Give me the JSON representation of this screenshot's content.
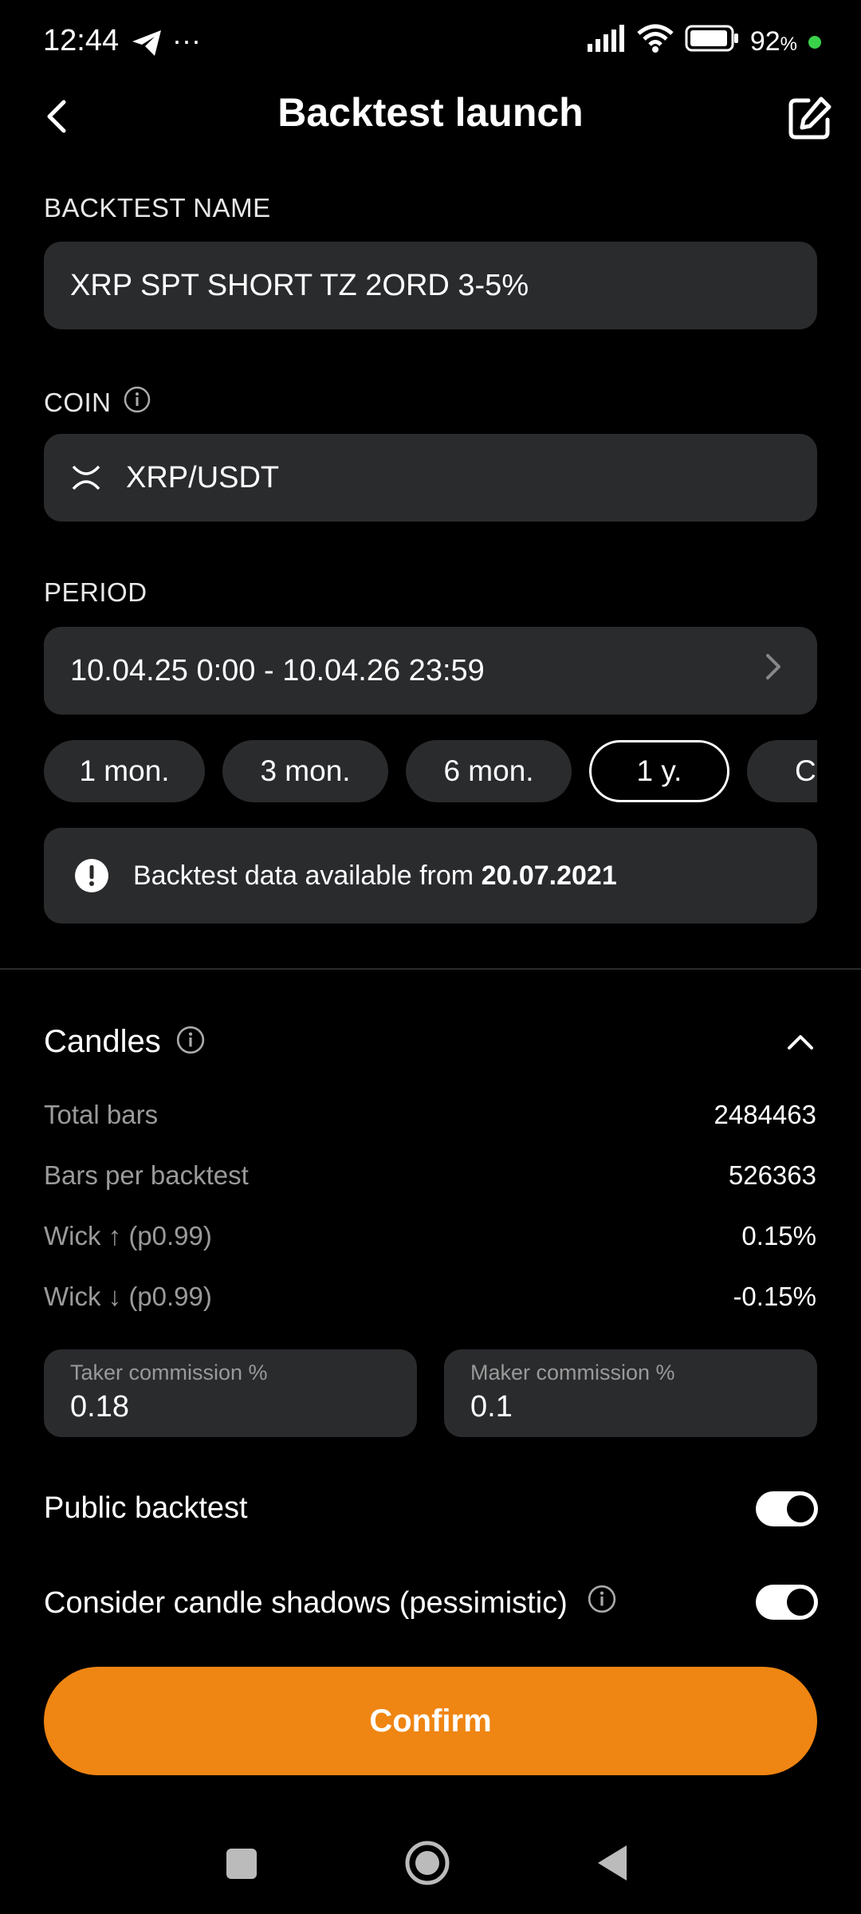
{
  "status": {
    "time": "12:44",
    "more": "···",
    "battery": "92",
    "battery_unit": "%"
  },
  "header": {
    "title": "Backtest launch"
  },
  "name_section": {
    "label": "BACKTEST NAME",
    "value": "XRP SPT SHORT TZ 2ORD 3-5%"
  },
  "coin_section": {
    "label": "COIN",
    "value": "XRP/USDT"
  },
  "period_section": {
    "label": "PERIOD",
    "value": "10.04.25 0:00 - 10.04.26 23:59",
    "chips": [
      "1 mon.",
      "3 mon.",
      "6 mon.",
      "1 y.",
      "C"
    ],
    "active_chip": "1 y."
  },
  "info": {
    "text": "Backtest data available from ",
    "date": "20.07.2021"
  },
  "candles": {
    "title": "Candles",
    "rows": [
      {
        "label": "Total bars",
        "value": "2484463"
      },
      {
        "label": "Bars per backtest",
        "value": "526363"
      },
      {
        "label": "Wick ↑ (p0.99)",
        "value": "0.15%"
      },
      {
        "label": "Wick ↓ (p0.99)",
        "value": "-0.15%"
      }
    ]
  },
  "commission": {
    "taker_label": "Taker commission %",
    "taker_value": "0.18",
    "maker_label": "Maker commission %",
    "maker_value": "0.1"
  },
  "toggles": {
    "public_label": "Public backtest",
    "public_on": true,
    "shadows_label": "Consider candle shadows (pessimistic)",
    "shadows_on": true
  },
  "confirm_label": "Confirm",
  "colors": {
    "accent": "#ef8512",
    "field_bg": "#2a2b2d",
    "background": "#000000"
  },
  "icons": [
    "telegram-icon",
    "signal-icon",
    "wifi-icon",
    "battery-icon",
    "back-icon",
    "edit-icon",
    "info-icon",
    "xrp-icon",
    "chevron-right-icon",
    "alert-icon",
    "chevron-up-icon",
    "home-icon",
    "recents-icon",
    "nav-back-icon"
  ]
}
